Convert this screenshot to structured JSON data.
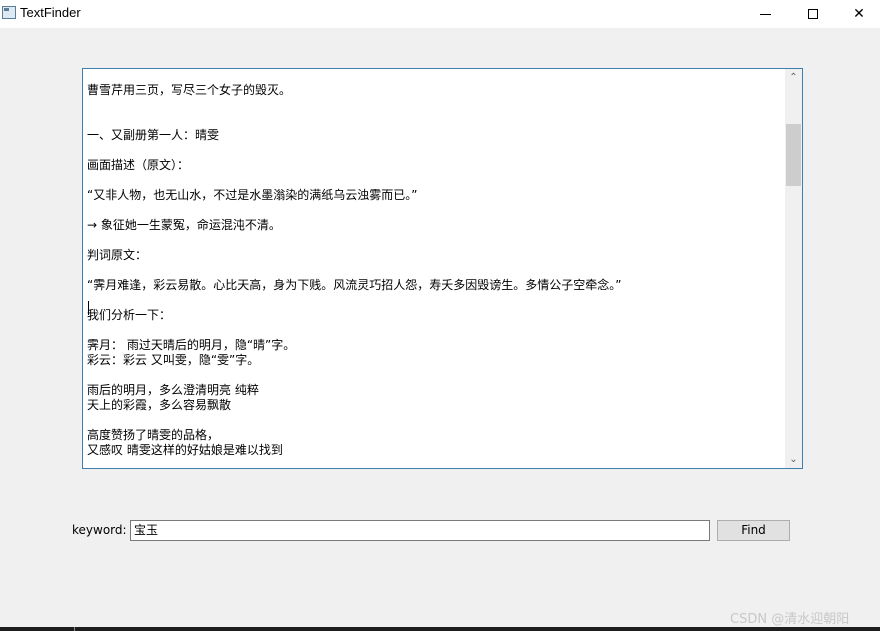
{
  "window": {
    "title": "TextFinder",
    "icon": "app-window-icon",
    "controls": {
      "minimize": "minimize-icon",
      "maximize": "maximize-icon",
      "close": "close-icon",
      "close_glyph": "✕"
    }
  },
  "textarea": {
    "lines": [
      "曹雪芹用三页，写尽三个女子的毁灭。",
      "",
      "",
      "一、又副册第一人：晴雯",
      "",
      "画面描述（原文）：",
      "",
      "“又非人物，也无山水，不过是水墨滃染的满纸乌云浊雾而已。”",
      "",
      "→ 象征她一生蒙冤，命运混沌不清。",
      "",
      "判词原文：",
      "",
      "“霁月难逢，彩云易散。心比天高，身为下贱。风流灵巧招人怨，寿夭多因毁谤生。多情公子空牵念。”",
      "",
      "我们分析一下：",
      "",
      "霁月：  雨过天晴后的明月，隐“晴”字。",
      "彩云：彩云 又叫雯，隐“雯”字。",
      "",
      "雨后的明月，多么澄清明亮 纯粹",
      "天上的彩霞，多么容易飘散",
      "",
      "高度赞扬了晴雯的品格，",
      "又感叹 晴雯这样的好姑娘是难以找到"
    ],
    "scroll_up_glyph": "⌃",
    "scroll_down_glyph": "⌄"
  },
  "search": {
    "label": "keyword:",
    "value": "宝玉",
    "button": "Find"
  },
  "watermark": "CSDN @清水迎朝阳"
}
